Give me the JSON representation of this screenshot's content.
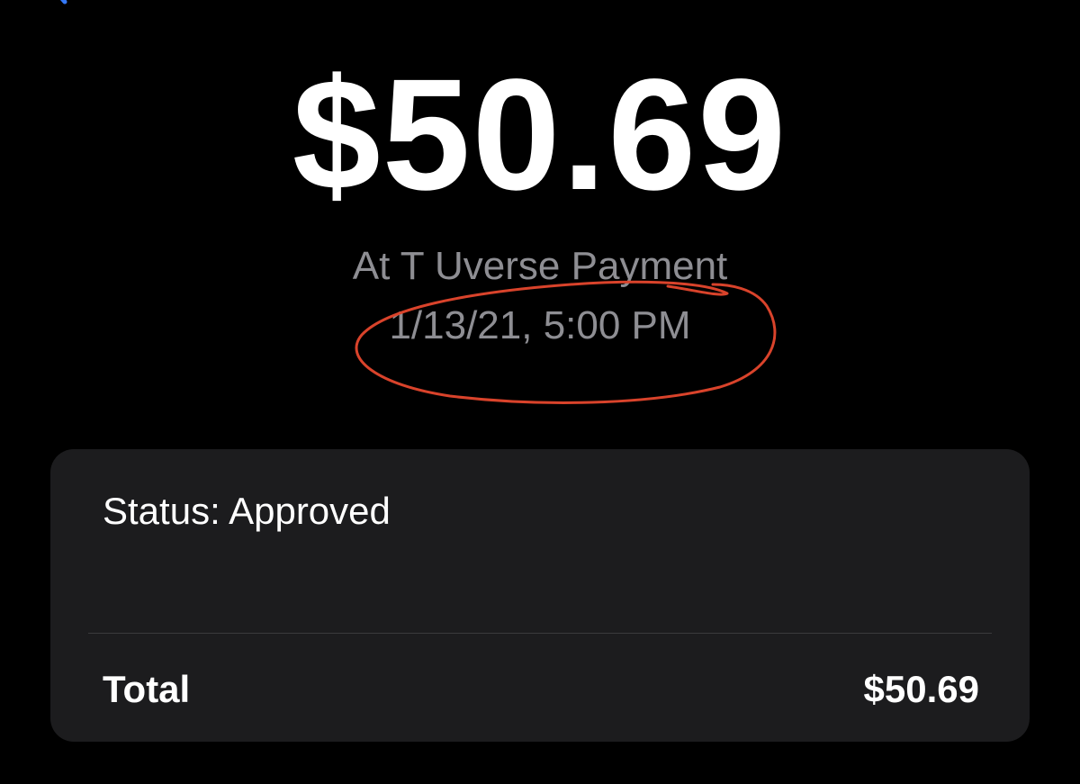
{
  "nav": {
    "back_icon": "chevron-left-icon",
    "accent_color": "#3478f6"
  },
  "transaction": {
    "amount": "$50.69",
    "merchant": "At T Uverse Payment",
    "datetime": "1/13/21, 5:00 PM"
  },
  "details": {
    "status": "Status: Approved",
    "total_label": "Total",
    "total_value": "$50.69"
  },
  "annotation": {
    "color": "#d9432b",
    "shape": "hand-drawn-circle"
  }
}
